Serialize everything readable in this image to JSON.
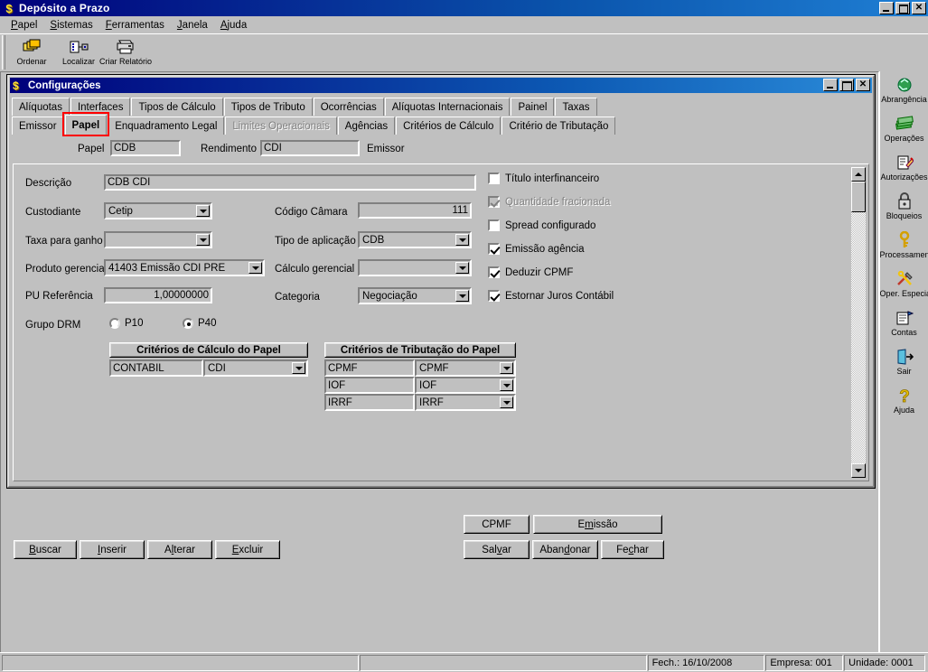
{
  "app": {
    "title": "Depósito a Prazo",
    "icon": "dollar-icon",
    "window_buttons": [
      "minimize",
      "restore",
      "close"
    ]
  },
  "menu": [
    {
      "label": "Papel",
      "accel": "P"
    },
    {
      "label": "Sistemas",
      "accel": "S"
    },
    {
      "label": "Ferramentas",
      "accel": "F"
    },
    {
      "label": "Janela",
      "accel": "J"
    },
    {
      "label": "Ajuda",
      "accel": "A"
    }
  ],
  "toolbar": [
    {
      "label": "Ordenar",
      "icon": "sort-cards-icon"
    },
    {
      "label": "Localizar",
      "icon": "find-list-icon"
    },
    {
      "label": "Criar Relatório",
      "icon": "printer-icon"
    }
  ],
  "child_window": {
    "title": "Configurações",
    "icon": "dollar-icon",
    "window_buttons": [
      "minimize",
      "maximize",
      "close"
    ]
  },
  "tabs_row1": [
    {
      "label": "Alíquotas",
      "state": "normal"
    },
    {
      "label": "Interfaces",
      "state": "normal"
    },
    {
      "label": "Tipos de Cálculo",
      "state": "normal"
    },
    {
      "label": "Tipos de Tributo",
      "state": "normal"
    },
    {
      "label": "Ocorrências",
      "state": "normal"
    },
    {
      "label": "Alíquotas Internacionais",
      "state": "normal"
    },
    {
      "label": "Painel",
      "state": "normal"
    },
    {
      "label": "Taxas",
      "state": "normal"
    }
  ],
  "tabs_row2": [
    {
      "label": "Emissor",
      "state": "normal"
    },
    {
      "label": "Papel",
      "state": "active"
    },
    {
      "label": "Enquadramento Legal",
      "state": "normal"
    },
    {
      "label": "Limites Operacionais",
      "state": "disabled"
    },
    {
      "label": "Agências",
      "state": "normal"
    },
    {
      "label": "Critérios de Cálculo",
      "state": "normal"
    },
    {
      "label": "Critério de Tributação",
      "state": "normal"
    }
  ],
  "highlight_color": "#ff0000",
  "header": {
    "papel_label": "Papel",
    "papel_value": "CDB",
    "rendimento_label": "Rendimento",
    "rendimento_value": "CDI",
    "emissor_label": "Emissor"
  },
  "form": {
    "descricao_label": "Descrição",
    "descricao_value": "CDB CDI",
    "custodiante_label": "Custodiante",
    "custodiante_value": "Cetip",
    "taxa_ganho_label": "Taxa para ganho",
    "taxa_ganho_value": "",
    "produto_gerencial_label": "Produto gerencial",
    "produto_gerencial_value": "41403 Emissão CDI PRE",
    "pu_referencia_label": "PU Referência",
    "pu_referencia_value": "1,00000000",
    "grupo_drm_label": "Grupo DRM",
    "grupo_drm_options": [
      {
        "label": "P10",
        "selected": false
      },
      {
        "label": "P40",
        "selected": true
      }
    ],
    "codigo_camara_label": "Código Câmara",
    "codigo_camara_value": "111",
    "tipo_aplicacao_label": "Tipo de aplicação",
    "tipo_aplicacao_value": "CDB",
    "calculo_gerencial_label": "Cálculo gerencial",
    "calculo_gerencial_value": "",
    "categoria_label": "Categoria",
    "categoria_value": "Negociação"
  },
  "checkboxes": [
    {
      "label": "Título interfinanceiro",
      "checked": false,
      "disabled": false
    },
    {
      "label": "Quantidade fracionada",
      "checked": true,
      "disabled": true
    },
    {
      "label": "Spread configurado",
      "checked": false,
      "disabled": false
    },
    {
      "label": "Emissão agência",
      "checked": true,
      "disabled": false
    },
    {
      "label": "Deduzir CPMF",
      "checked": true,
      "disabled": false
    },
    {
      "label": "Estornar Juros Contábil",
      "checked": true,
      "disabled": false
    }
  ],
  "criterios_calculo": {
    "title": "Critérios de Cálculo do Papel",
    "rows": [
      {
        "name": "CONTABIL",
        "value": "CDI"
      }
    ]
  },
  "criterios_tributacao": {
    "title": "Critérios de Tributação do Papel",
    "rows": [
      {
        "name": "CPMF",
        "value": "CPMF"
      },
      {
        "name": "IOF",
        "value": "IOF"
      },
      {
        "name": "IRRF",
        "value": "IRRF"
      }
    ]
  },
  "action_buttons": {
    "cpmf": "CPMF",
    "emissao_pre": "E",
    "emissao_accel": "m",
    "emissao_post": "issão"
  },
  "bottom_buttons": [
    {
      "pre": "",
      "accel": "B",
      "post": "uscar"
    },
    {
      "pre": "",
      "accel": "I",
      "post": "nserir"
    },
    {
      "pre": "A",
      "accel": "l",
      "post": "terar"
    },
    {
      "pre": "",
      "accel": "E",
      "post": "xcluir"
    }
  ],
  "save_buttons": [
    {
      "pre": "Sal",
      "accel": "v",
      "post": "ar"
    },
    {
      "pre": "Aban",
      "accel": "d",
      "post": "onar"
    },
    {
      "pre": "Fe",
      "accel": "c",
      "post": "har"
    }
  ],
  "sidebar": [
    {
      "label": "Abrangência",
      "icon": "globe-recycle-icon"
    },
    {
      "label": "Operações",
      "icon": "money-stack-icon"
    },
    {
      "label": "Autorizações",
      "icon": "document-pencil-icon"
    },
    {
      "label": "Bloqueios",
      "icon": "padlock-icon"
    },
    {
      "label": "Processamento",
      "icon": "key-icon"
    },
    {
      "label": "Oper. Especiais",
      "icon": "tools-icon"
    },
    {
      "label": "Contas",
      "icon": "notepad-flag-icon"
    },
    {
      "label": "Sair",
      "icon": "exit-door-icon"
    },
    {
      "label": "Ajuda",
      "icon": "question-mark-icon"
    }
  ],
  "statusbar": {
    "fechamento": "Fech.:  16/10/2008",
    "empresa": "Empresa: 001",
    "unidade": "Unidade: 0001"
  }
}
